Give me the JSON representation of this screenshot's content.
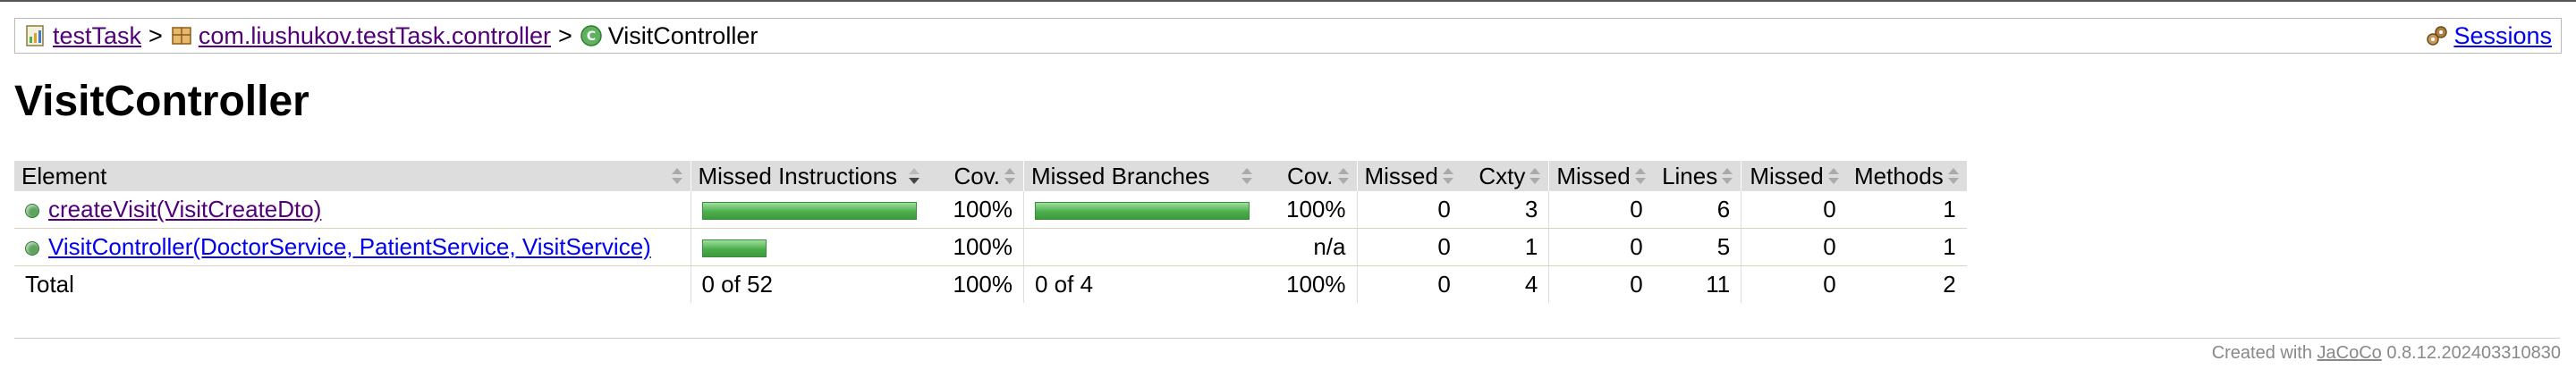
{
  "breadcrumb": {
    "project": "testTask",
    "package": "com.liushukov.testTask.controller",
    "current": "VisitController",
    "separator": ">",
    "sessions_label": "Sessions"
  },
  "page_title": "VisitController",
  "table": {
    "headers": [
      "Element",
      "Missed Instructions",
      "Cov.",
      "Missed Branches",
      "Cov.",
      "Missed",
      "Cxty",
      "Missed",
      "Lines",
      "Missed",
      "Methods"
    ],
    "rows": [
      {
        "element": "createVisit(VisitCreateDto)",
        "instructions_coverage": 1.0,
        "instr_cov": "100%",
        "branches_coverage": 1.0,
        "branch_cov": "100%",
        "missed_cxty": "0",
        "cxty": "3",
        "missed_lines": "0",
        "lines": "6",
        "missed_methods": "0",
        "methods": "1"
      },
      {
        "element": "VisitController(DoctorService, PatientService, VisitService)",
        "instructions_coverage": 1.0,
        "instr_cov": "100%",
        "branches_coverage": null,
        "branch_cov": "n/a",
        "missed_cxty": "0",
        "cxty": "1",
        "missed_lines": "0",
        "lines": "5",
        "missed_methods": "0",
        "methods": "1"
      }
    ],
    "total": {
      "label": "Total",
      "missed_instructions": "0 of 52",
      "instr_cov": "100%",
      "missed_branches": "0 of 4",
      "branch_cov": "100%",
      "missed_cxty": "0",
      "cxty": "4",
      "missed_lines": "0",
      "lines": "11",
      "missed_methods": "0",
      "methods": "2"
    }
  },
  "footer": {
    "prefix": "Created with",
    "tool": "JaCoCo",
    "version": "0.8.12.202403310830"
  },
  "colors": {
    "bar_green": "#4cae4c",
    "header_bg": "#dddddd",
    "link": "#0000ee",
    "visited": "#520079"
  },
  "icons": [
    "report-icon",
    "package-icon",
    "class-icon",
    "sessions-icon",
    "method-icon",
    "sort-icon"
  ]
}
